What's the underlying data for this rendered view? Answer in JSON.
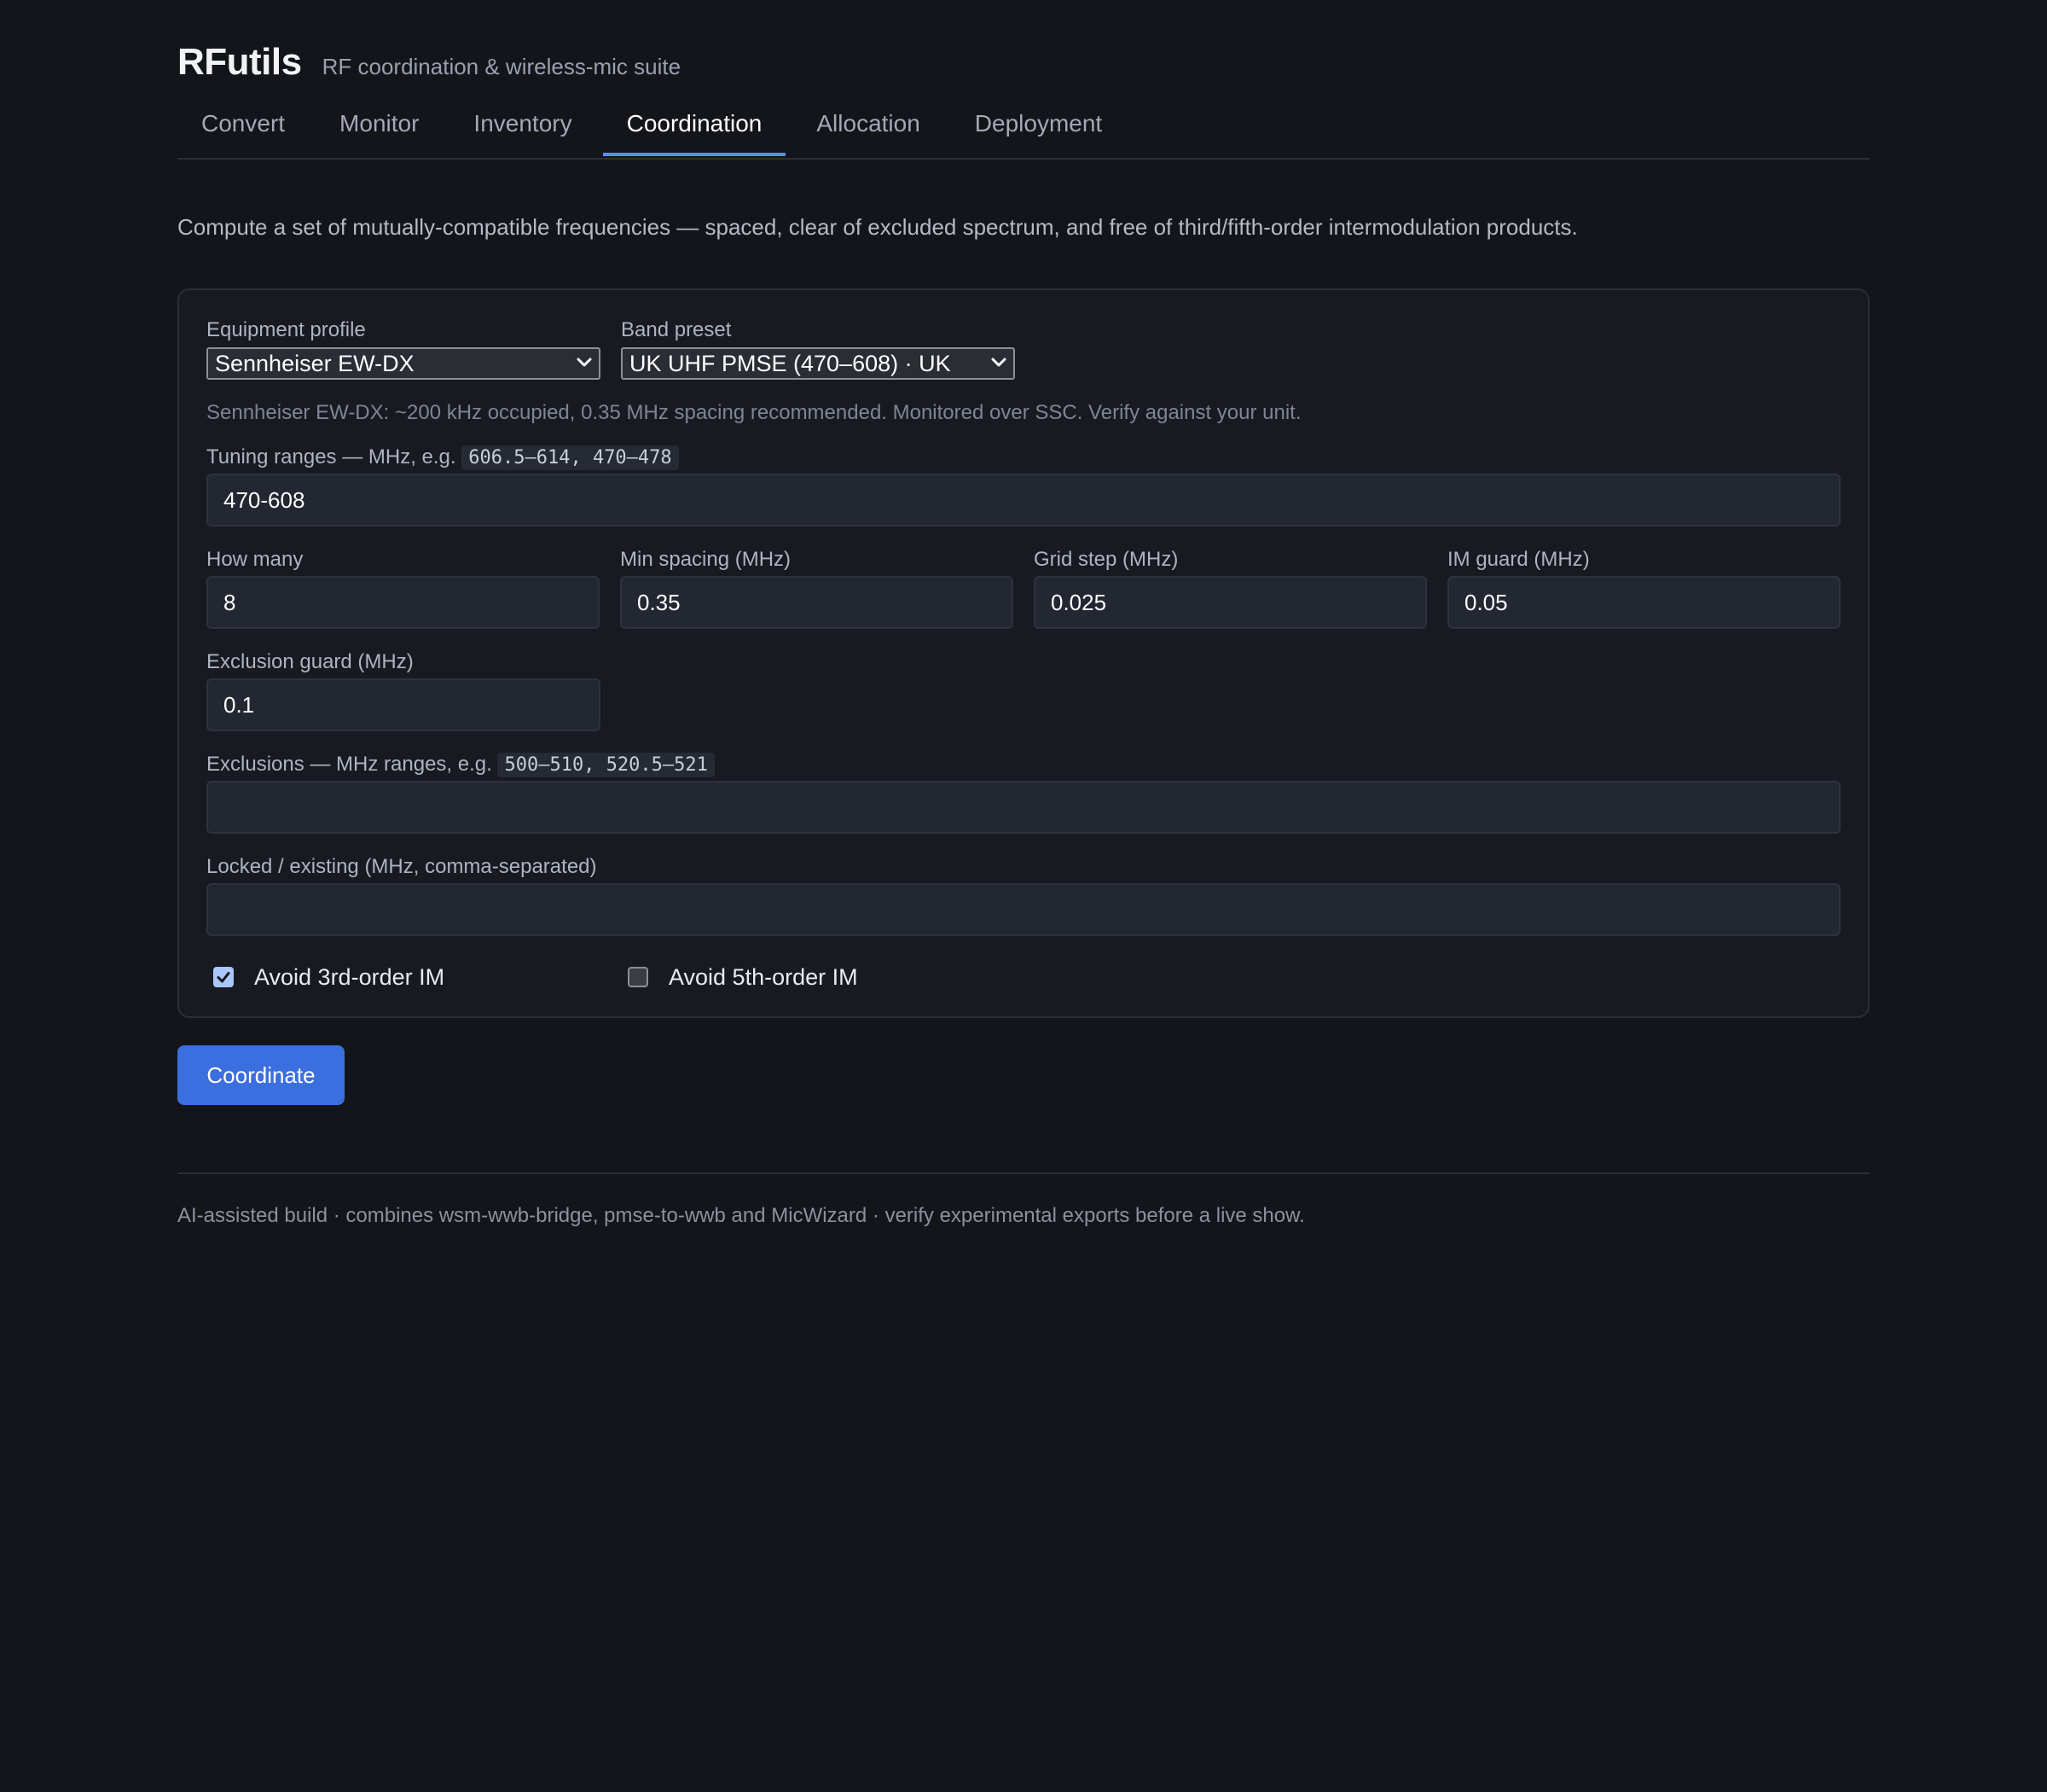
{
  "app": {
    "title": "RFutils",
    "subtitle": "RF coordination & wireless-mic suite"
  },
  "tabs": [
    {
      "label": "Convert",
      "active": false
    },
    {
      "label": "Monitor",
      "active": false
    },
    {
      "label": "Inventory",
      "active": false
    },
    {
      "label": "Coordination",
      "active": true
    },
    {
      "label": "Allocation",
      "active": false
    },
    {
      "label": "Deployment",
      "active": false
    }
  ],
  "description": "Compute a set of mutually-compatible frequencies — spaced, clear of excluded spectrum, and free of third/fifth-order intermodulation products.",
  "form": {
    "equipment_profile": {
      "label": "Equipment profile",
      "value": "Sennheiser EW-DX"
    },
    "band_preset": {
      "label": "Band preset",
      "value": "UK UHF PMSE (470–608) · UK"
    },
    "profile_hint": "Sennheiser EW-DX: ~200 kHz occupied, 0.35 MHz spacing recommended. Monitored over SSC. Verify against your unit.",
    "tuning_ranges": {
      "label": "Tuning ranges — MHz, e.g.",
      "example": "606.5–614, 470–478",
      "value": "470-608"
    },
    "how_many": {
      "label": "How many",
      "value": "8"
    },
    "min_spacing": {
      "label": "Min spacing (MHz)",
      "value": "0.35"
    },
    "grid_step": {
      "label": "Grid step (MHz)",
      "value": "0.025"
    },
    "im_guard": {
      "label": "IM guard (MHz)",
      "value": "0.05"
    },
    "exclusion_guard": {
      "label": "Exclusion guard (MHz)",
      "value": "0.1"
    },
    "exclusions": {
      "label": "Exclusions — MHz ranges, e.g.",
      "example": "500–510, 520.5–521",
      "value": ""
    },
    "locked": {
      "label": "Locked / existing (MHz, comma-separated)",
      "value": ""
    },
    "avoid_3rd": {
      "label": "Avoid 3rd-order IM",
      "checked": true
    },
    "avoid_5th": {
      "label": "Avoid 5th-order IM",
      "checked": false
    }
  },
  "actions": {
    "coordinate_label": "Coordinate"
  },
  "footer": "AI-assisted build · combines wsm-wwb-bridge, pmse-to-wwb and MicWizard · verify experimental exports before a live show.",
  "colors": {
    "background": "#13151b",
    "accent": "#3b6fe0",
    "tab_underline": "#5b8def"
  }
}
